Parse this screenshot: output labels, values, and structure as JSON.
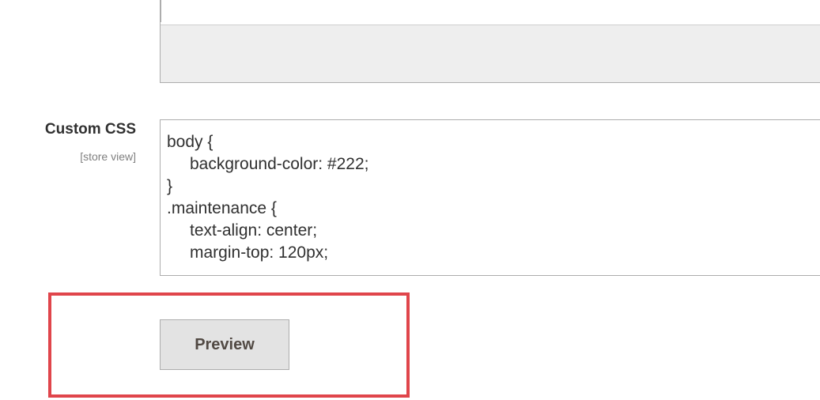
{
  "previous_field": {},
  "custom_css_field": {
    "label": "Custom CSS",
    "scope": "[store view]",
    "lines": [
      {
        "text": "body {",
        "indent": false
      },
      {
        "text": "background-color: #222;",
        "indent": true
      },
      {
        "text": "}",
        "indent": false
      },
      {
        "text": ".maintenance {",
        "indent": false
      },
      {
        "text": "text-align: center;",
        "indent": true
      },
      {
        "text": "margin-top: 120px;",
        "indent": true
      }
    ]
  },
  "preview": {
    "button_label": "Preview",
    "highlight_color": "#e0454b"
  }
}
